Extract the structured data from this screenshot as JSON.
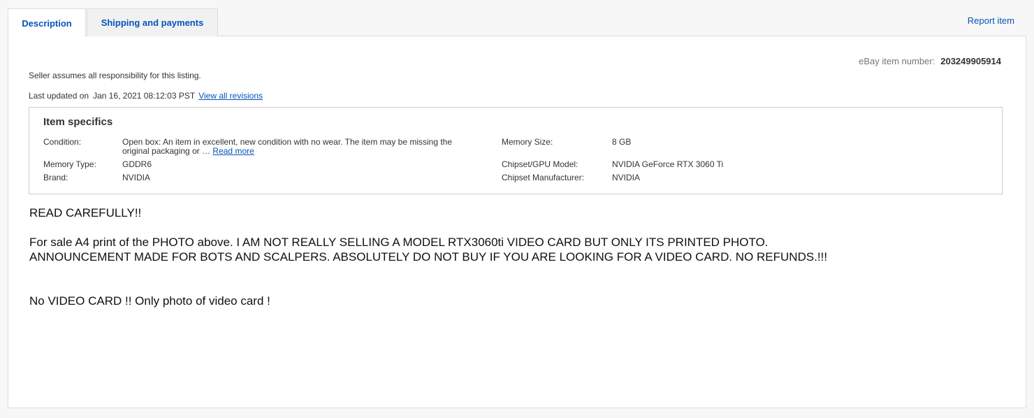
{
  "tabs": [
    {
      "label": "Description",
      "active": true
    },
    {
      "label": "Shipping and payments",
      "active": false
    }
  ],
  "report_item": "Report item",
  "item_number": {
    "label": "eBay item number:",
    "value": "203249905914"
  },
  "responsibility": "Seller assumes all responsibility for this listing.",
  "last_updated": {
    "label": "Last updated on",
    "date": "Jan 16, 2021 08:12:03 PST",
    "link": "View all revisions"
  },
  "item_specifics": {
    "title": "Item specifics",
    "condition_label": "Condition:",
    "condition_value_line1": "Open box: An item in excellent, new condition with no wear. The item may be missing the",
    "condition_value_line2": "original packaging or …",
    "read_more": "Read more",
    "memory_type_label": "Memory Type:",
    "memory_type_value": "GDDR6",
    "brand_label": "Brand:",
    "brand_value": "NVIDIA",
    "memory_size_label": "Memory Size:",
    "memory_size_value": "8 GB",
    "chipset_model_label": "Chipset/GPU Model:",
    "chipset_model_value": "NVIDIA GeForce RTX 3060 Ti",
    "chipset_manufacturer_label": "Chipset Manufacturer:",
    "chipset_manufacturer_value": "NVIDIA"
  },
  "description": {
    "line1": "READ CAREFULLY!!",
    "line2": "For sale A4 print of the PHOTO above. I AM NOT REALLY SELLING A MODEL RTX3060ti VIDEO CARD BUT ONLY ITS PRINTED PHOTO.",
    "line3": "ANNOUNCEMENT MADE FOR BOTS AND SCALPERS. ABSOLUTELY DO NOT BUY IF YOU ARE LOOKING FOR A VIDEO CARD. NO REFUNDS.!!!",
    "line4": "No VIDEO CARD !! Only photo of video card !"
  }
}
